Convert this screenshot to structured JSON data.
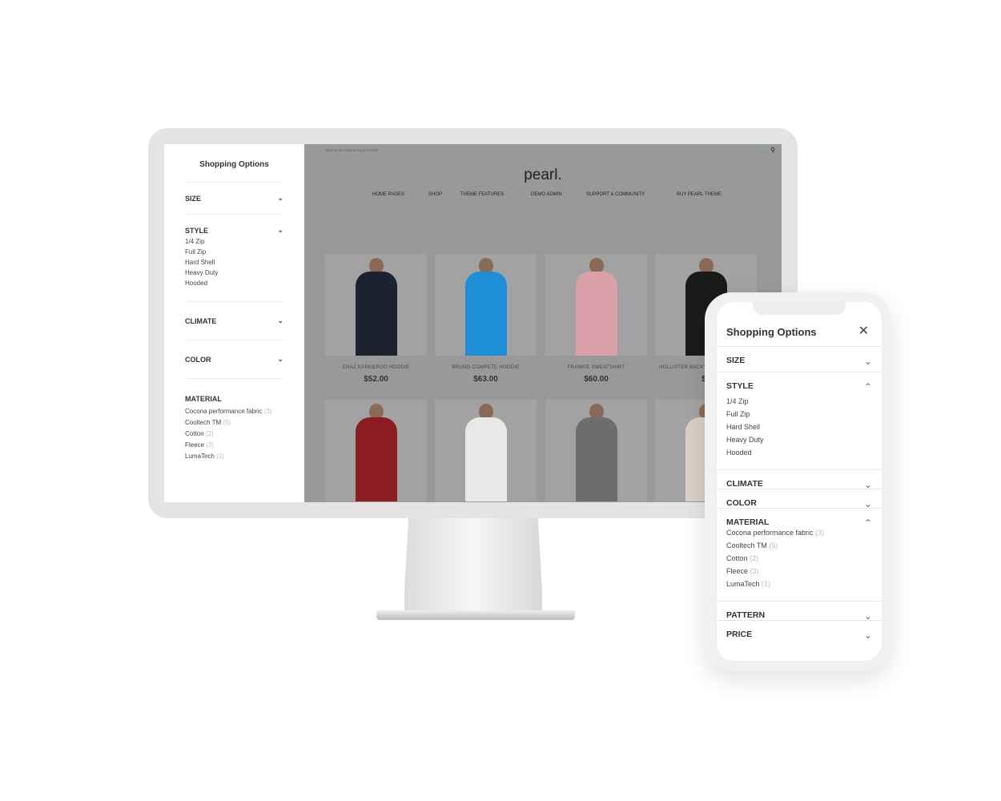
{
  "desktop": {
    "sidebar": {
      "title": "Shopping Options",
      "sections": [
        {
          "label": "SIZE"
        },
        {
          "label": "STYLE",
          "options": [
            "1/4 Zip",
            "Full Zip",
            "Hard Shell",
            "Heavy Duty",
            "Hooded"
          ]
        },
        {
          "label": "CLIMATE"
        },
        {
          "label": "COLOR"
        },
        {
          "label": "MATERIAL",
          "options": [
            {
              "name": "Cocona performance fabric",
              "count": "(3)"
            },
            {
              "name": "Cooltech TM",
              "count": "(5)"
            },
            {
              "name": "Cotton",
              "count": "(2)"
            },
            {
              "name": "Fleece",
              "count": "(3)"
            },
            {
              "name": "LumaTech",
              "count": "(1)"
            }
          ]
        }
      ]
    },
    "header": {
      "signin": "SIGN IN OR CREATE AN ACCOUNT",
      "logo": "pearl.",
      "nav": [
        "HOME PAGES",
        "SHOP",
        "THEME FEATURES",
        "DEMO ADMIN",
        "SUPPORT & COMMUNITY",
        "BUY PEARL THEME"
      ]
    },
    "products": [
      {
        "name": "CHAZ KANGEROO HOODIE",
        "price": "$52.00",
        "color": "#1c2230"
      },
      {
        "name": "BRUNO COMPETE HOODIE",
        "price": "$63.00",
        "color": "#1e8fd6"
      },
      {
        "name": "FRANKIE SWEATSHIRT",
        "price": "$60.00",
        "color": "#d9a0a8"
      },
      {
        "name": "HOLLISTER BACKYARD SWEATSHIRT",
        "price": "$5",
        "color": "#1a1a1a"
      },
      {
        "color": "#8c1c22"
      },
      {
        "color": "#e8e8e8"
      },
      {
        "color": "#6d6d6d"
      },
      {
        "color": "#d8cfc6"
      }
    ]
  },
  "mobile": {
    "title": "Shopping Options",
    "sections": [
      {
        "label": "SIZE",
        "open": false
      },
      {
        "label": "STYLE",
        "open": true,
        "options": [
          "1/4 Zip",
          "Full Zip",
          "Hard Shell",
          "Heavy Duty",
          "Hooded"
        ]
      },
      {
        "label": "CLIMATE",
        "open": false
      },
      {
        "label": "COLOR",
        "open": false
      },
      {
        "label": "MATERIAL",
        "open": true,
        "options": [
          {
            "name": "Cocona performance fabric",
            "count": "(3)"
          },
          {
            "name": "Cooltech TM",
            "count": "(5)"
          },
          {
            "name": "Cotton",
            "count": "(2)"
          },
          {
            "name": "Fleece",
            "count": "(3)"
          },
          {
            "name": "LumaTech",
            "count": "(1)"
          }
        ]
      },
      {
        "label": "PATTERN",
        "open": false
      },
      {
        "label": "PRICE",
        "open": false
      }
    ]
  }
}
